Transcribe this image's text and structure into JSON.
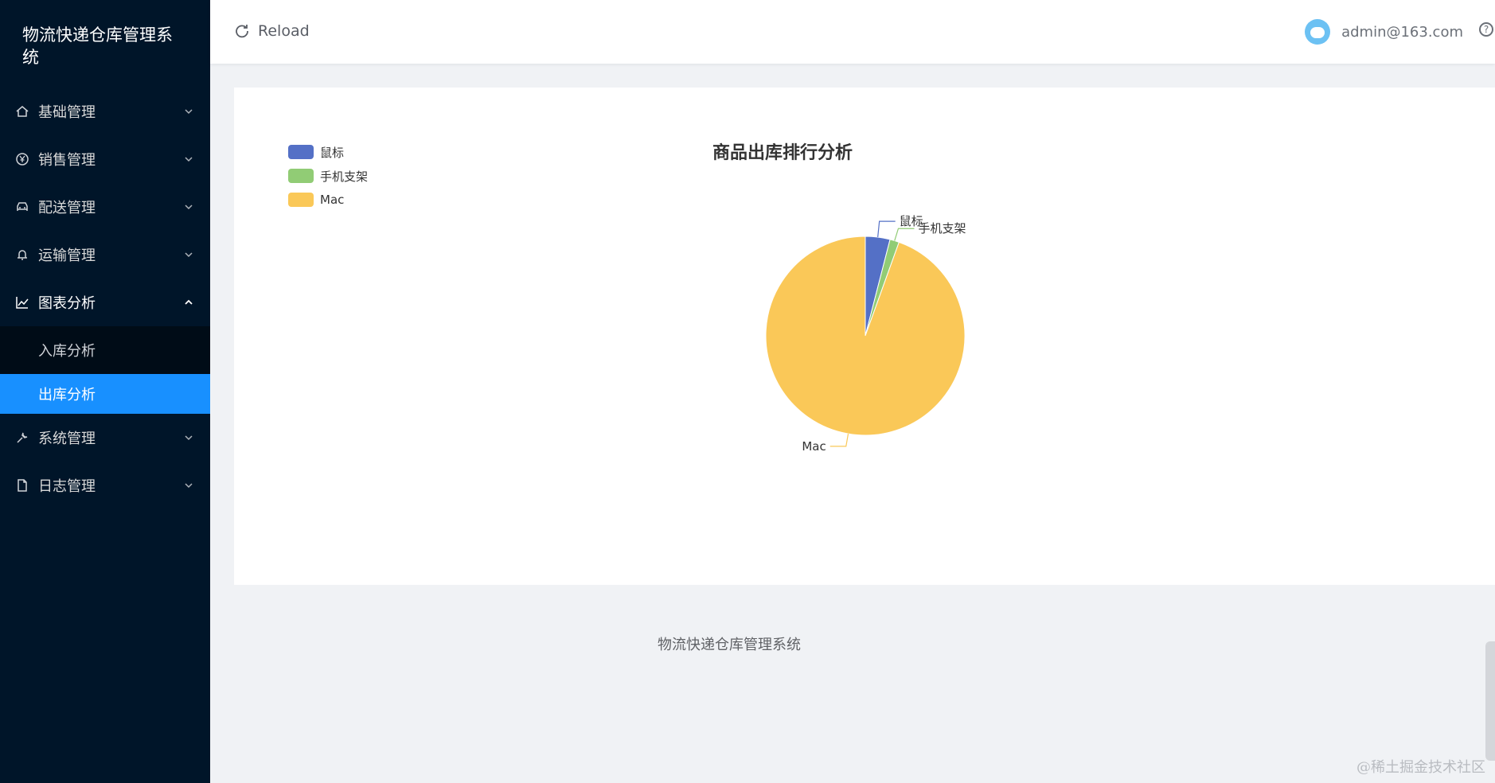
{
  "app": {
    "title": "物流快递仓库管理系统"
  },
  "sidebar": {
    "items": [
      {
        "label": "基础管理",
        "icon": "home-icon"
      },
      {
        "label": "销售管理",
        "icon": "yen-icon"
      },
      {
        "label": "配送管理",
        "icon": "car-icon"
      },
      {
        "label": "运输管理",
        "icon": "bell-icon"
      },
      {
        "label": "图表分析",
        "icon": "line-chart-icon",
        "expanded": true,
        "children": [
          {
            "label": "入库分析"
          },
          {
            "label": "出库分析",
            "active": true
          }
        ]
      },
      {
        "label": "系统管理",
        "icon": "wrench-icon"
      },
      {
        "label": "日志管理",
        "icon": "document-icon"
      }
    ]
  },
  "header": {
    "reload_label": "Reload",
    "user_email": "admin@163.com"
  },
  "chart_data": {
    "type": "pie",
    "title": "商品出库排行分析",
    "legend_position": "top-left",
    "slices": [
      {
        "name": "鼠标",
        "value": 4,
        "color": "#5470c6"
      },
      {
        "name": "手机支架",
        "value": 1.5,
        "color": "#91cc75"
      },
      {
        "name": "Mac",
        "value": 94.5,
        "color": "#fac858"
      }
    ]
  },
  "footer": {
    "text": "物流快递仓库管理系统"
  },
  "watermark": "@稀土掘金技术社区"
}
